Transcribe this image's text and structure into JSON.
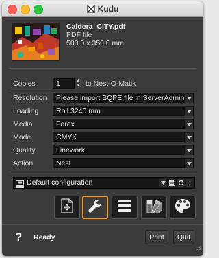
{
  "window": {
    "title": "Kudu"
  },
  "file": {
    "name": "Caldera_CITY.pdf",
    "type": "PDF file",
    "dimensions": "500.0 x 350.0 mm"
  },
  "settings": {
    "copies": {
      "label": "Copies",
      "value": "1",
      "suffix": "to Nest-O-Matik"
    },
    "rows": [
      {
        "label": "Resolution",
        "value": "Please import SQPE file in ServerAdmin"
      },
      {
        "label": "Loading",
        "value": "Roll 3240 mm"
      },
      {
        "label": "Media",
        "value": "Forex"
      },
      {
        "label": "Mode",
        "value": "CMYK"
      },
      {
        "label": "Quality",
        "value": "Linework"
      },
      {
        "label": "Action",
        "value": "Nest"
      }
    ]
  },
  "configuration": {
    "value": "Default configuration",
    "more_label": "..."
  },
  "toolbar": [
    {
      "icon": "add-page-icon",
      "active": false
    },
    {
      "icon": "wrench-icon",
      "active": true
    },
    {
      "icon": "list-icon",
      "active": false
    },
    {
      "icon": "swatches-icon",
      "active": false
    },
    {
      "icon": "palette-icon",
      "active": false
    }
  ],
  "footer": {
    "help_label": "?",
    "status": "Ready",
    "print_label": "Print",
    "quit_label": "Quit"
  },
  "colors": {
    "accent": "#e8a33a",
    "window_bg": "#3b3b3b",
    "field_bg": "#161616"
  }
}
